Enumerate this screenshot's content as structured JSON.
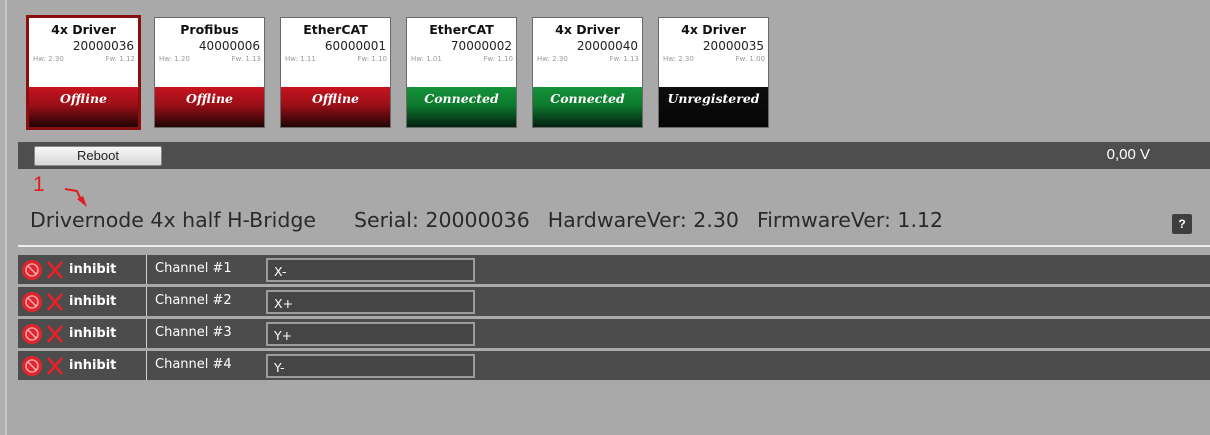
{
  "devices": [
    {
      "type": "4x Driver",
      "serial": "20000036",
      "hw": "Hw: 2.30",
      "fw": "Fw: 1.12",
      "status": "Offline"
    },
    {
      "type": "Profibus",
      "serial": "40000006",
      "hw": "Hw: 1.20",
      "fw": "Fw: 1.13",
      "status": "Offline"
    },
    {
      "type": "EtherCAT",
      "serial": "60000001",
      "hw": "Hw: 1.11",
      "fw": "Fw: 1.10",
      "status": "Offline"
    },
    {
      "type": "EtherCAT",
      "serial": "70000002",
      "hw": "Hw: 1.01",
      "fw": "Fw: 1.10",
      "status": "Connected"
    },
    {
      "type": "4x Driver",
      "serial": "20000040",
      "hw": "Hw: 2.30",
      "fw": "Fw: 1.13",
      "status": "Connected"
    },
    {
      "type": "4x Driver",
      "serial": "20000035",
      "hw": "Hw: 2.30",
      "fw": "Fw: 1.00",
      "status": "Unregistered"
    }
  ],
  "toolbar": {
    "reboot_label": "Reboot",
    "voltage": "0,00 V"
  },
  "annotation": {
    "number": "1"
  },
  "info": {
    "description": "Drivernode 4x half H-Bridge",
    "serial": "Serial: 20000036",
    "hardware": "HardwareVer: 2.30",
    "firmware": "FirmwareVer: 1.12",
    "help_label": "?"
  },
  "channels": [
    {
      "inhibit_label": "inhibit",
      "label": "Channel #1",
      "name": "X-"
    },
    {
      "inhibit_label": "inhibit",
      "label": "Channel #2",
      "name": "X+"
    },
    {
      "inhibit_label": "inhibit",
      "label": "Channel #3",
      "name": "Y+"
    },
    {
      "inhibit_label": "inhibit",
      "label": "Channel #4",
      "name": "Y-"
    }
  ],
  "colors": {
    "offline": "#c7141f",
    "connected": "#14923a",
    "unregistered": "#0e0e0e",
    "annotation": "#e21b1b",
    "stop_icon": "#e0262c"
  }
}
